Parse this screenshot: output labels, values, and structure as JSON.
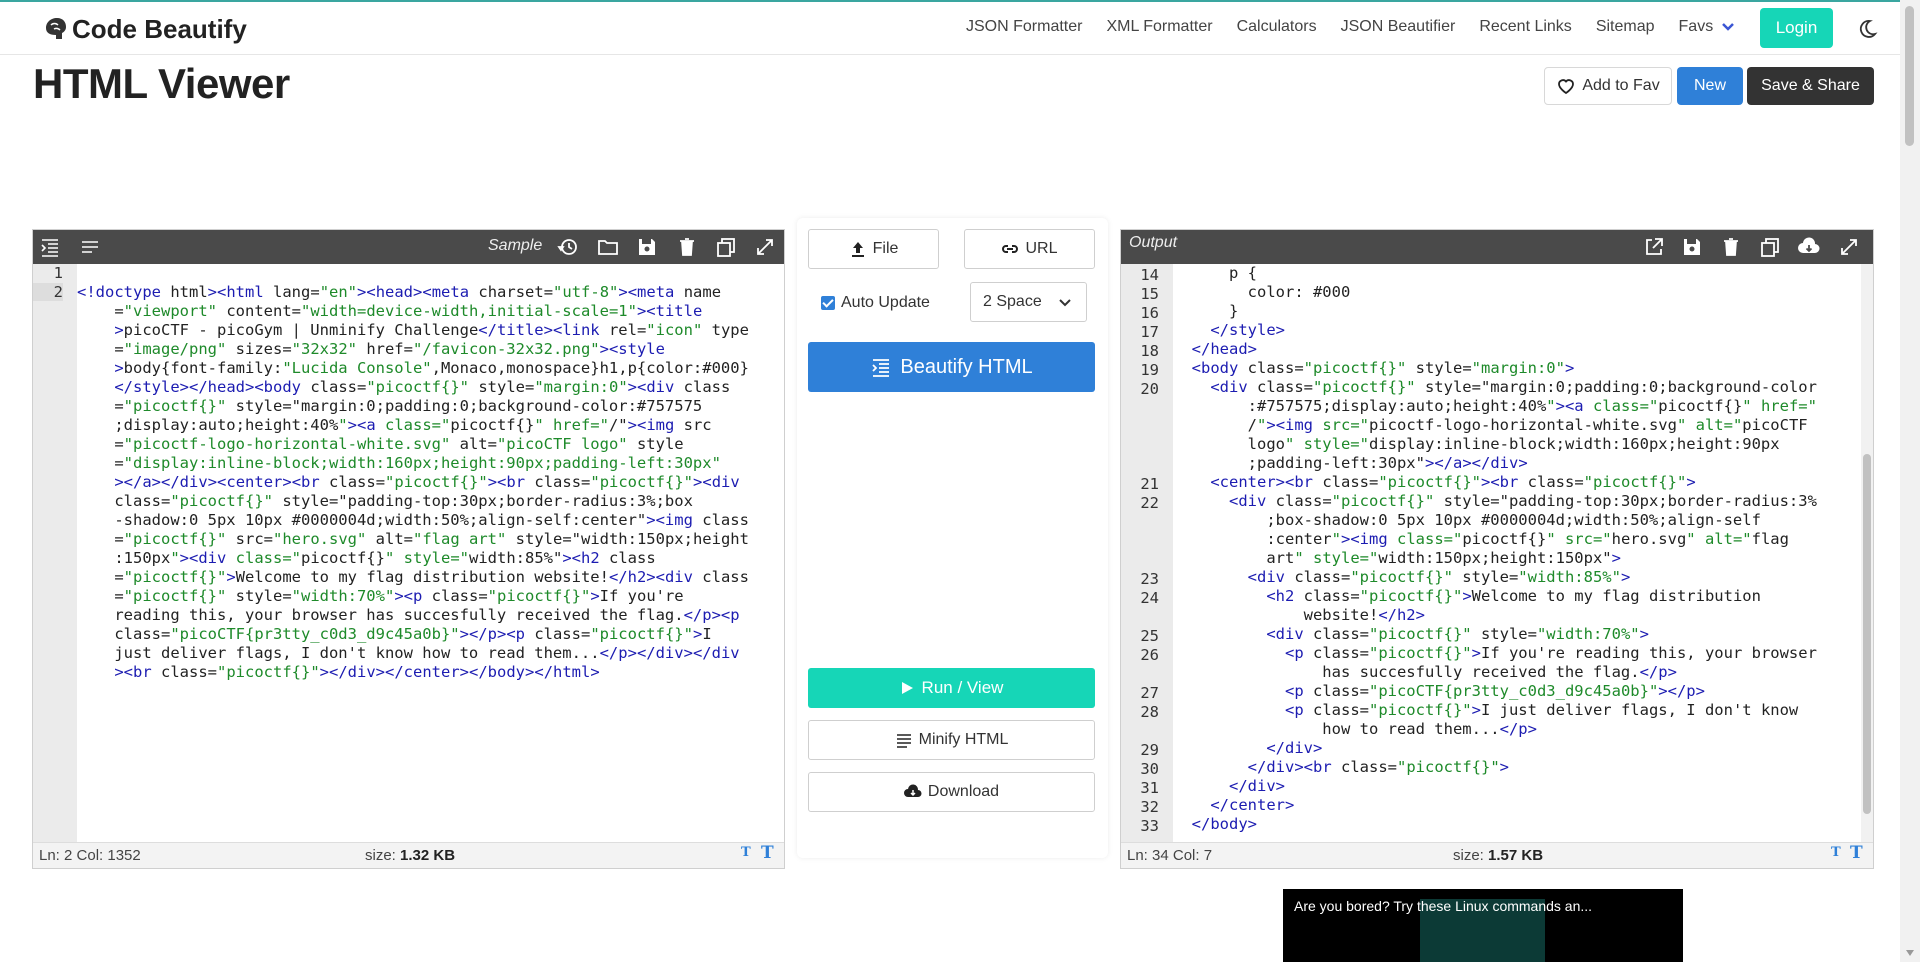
{
  "brand": {
    "name": "Code Beautify"
  },
  "nav": {
    "links": [
      "JSON Formatter",
      "XML Formatter",
      "Calculators",
      "JSON Beautifier",
      "Recent Links",
      "Sitemap"
    ],
    "favs": "Favs",
    "login": "Login"
  },
  "header": {
    "title": "HTML Viewer",
    "add_fav": "Add to Fav",
    "new": "New",
    "save_share": "Save & Share"
  },
  "input_panel": {
    "sample_label": "Sample",
    "status_pos": "Ln: 2 Col: 1352",
    "size_label": "size:",
    "size_value": "1.32 KB",
    "line_numbers": [
      "1",
      "2"
    ]
  },
  "output_panel": {
    "label": "Output",
    "status_pos": "Ln: 34 Col: 7",
    "size_label": "size:",
    "size_value": "1.57 KB",
    "line_numbers": [
      "14",
      "15",
      "16",
      "17",
      "18",
      "19",
      "20",
      "21",
      "22",
      "23",
      "24",
      "25",
      "26",
      "27",
      "28",
      "29",
      "30",
      "31",
      "32",
      "33"
    ]
  },
  "middle": {
    "file": "File",
    "url": "URL",
    "auto_update": "Auto Update",
    "indent": "2 Space",
    "beautify": "Beautify HTML",
    "run": "Run / View",
    "minify": "Minify HTML",
    "download": "Download"
  },
  "video": {
    "caption": "Are you bored? Try these Linux commands an..."
  },
  "colors": {
    "accent_teal": "#16d6b7",
    "accent_blue": "#2f80d8",
    "toolbar": "#4a4a4a"
  },
  "input_code": [
    "",
    "<!doctype html><html lang=\"en\"><head><meta charset=\"utf-8\"><meta name",
    "    =\"viewport\" content=\"width=device-width,initial-scale=1\"><title",
    "    >picoCTF - picoGym | Unminify Challenge</title><link rel=\"icon\" type",
    "    =\"image/png\" sizes=\"32x32\" href=\"/favicon-32x32.png\"><style",
    "    >body{font-family:\"Lucida Console\",Monaco,monospace}h1,p{color:#000}",
    "    </style></head><body class=\"picoctf{}\" style=\"margin:0\"><div class",
    "    =\"picoctf{}\" style=\"margin:0;padding:0;background-color:#757575",
    "    ;display:auto;height:40%\"><a class=\"picoctf{}\" href=\"/\"><img src",
    "    =\"picoctf-logo-horizontal-white.svg\" alt=\"picoCTF logo\" style",
    "    =\"display:inline-block;width:160px;height:90px;padding-left:30px\"",
    "    ></a></div><center><br class=\"picoctf{}\"><br class=\"picoctf{}\"><div",
    "    class=\"picoctf{}\" style=\"padding-top:30px;border-radius:3%;box",
    "    -shadow:0 5px 10px #0000004d;width:50%;align-self:center\"><img class",
    "    =\"picoctf{}\" src=\"hero.svg\" alt=\"flag art\" style=\"width:150px;height",
    "    :150px\"><div class=\"picoctf{}\" style=\"width:85%\"><h2 class",
    "    =\"picoctf{}\">Welcome to my flag distribution website!</h2><div class",
    "    =\"picoctf{}\" style=\"width:70%\"><p class=\"picoctf{}\">If you're",
    "    reading this, your browser has succesfully received the flag.</p><p",
    "    class=\"picoCTF{pr3tty_c0d3_d9c45a0b}\"></p><p class=\"picoctf{}\">I",
    "    just deliver flags, I don't know how to read them...</p></div></div",
    "    ><br class=\"picoctf{}\"></div></center></body></html>"
  ],
  "output_code": [
    "      p {",
    "        color: #000",
    "      }",
    "    </style>",
    "  </head>",
    "  <body class=\"picoctf{}\" style=\"margin:0\">",
    "    <div class=\"picoctf{}\" style=\"margin:0;padding:0;background-color",
    "        :#757575;display:auto;height:40%\"><a class=\"picoctf{}\" href=\"",
    "        /\"><img src=\"picoctf-logo-horizontal-white.svg\" alt=\"picoCTF",
    "        logo\" style=\"display:inline-block;width:160px;height:90px",
    "        ;padding-left:30px\"></a></div>",
    "    <center><br class=\"picoctf{}\"><br class=\"picoctf{}\">",
    "      <div class=\"picoctf{}\" style=\"padding-top:30px;border-radius:3%",
    "          ;box-shadow:0 5px 10px #0000004d;width:50%;align-self",
    "          :center\"><img class=\"picoctf{}\" src=\"hero.svg\" alt=\"flag",
    "          art\" style=\"width:150px;height:150px\">",
    "        <div class=\"picoctf{}\" style=\"width:85%\">",
    "          <h2 class=\"picoctf{}\">Welcome to my flag distribution",
    "              website!</h2>",
    "          <div class=\"picoctf{}\" style=\"width:70%\">",
    "            <p class=\"picoctf{}\">If you're reading this, your browser",
    "                has succesfully received the flag.</p>",
    "            <p class=\"picoCTF{pr3tty_c0d3_d9c45a0b}\"></p>",
    "            <p class=\"picoctf{}\">I just deliver flags, I don't know",
    "                how to read them...</p>",
    "          </div>",
    "        </div><br class=\"picoctf{}\">",
    "      </div>",
    "    </center>",
    "  </body>"
  ]
}
